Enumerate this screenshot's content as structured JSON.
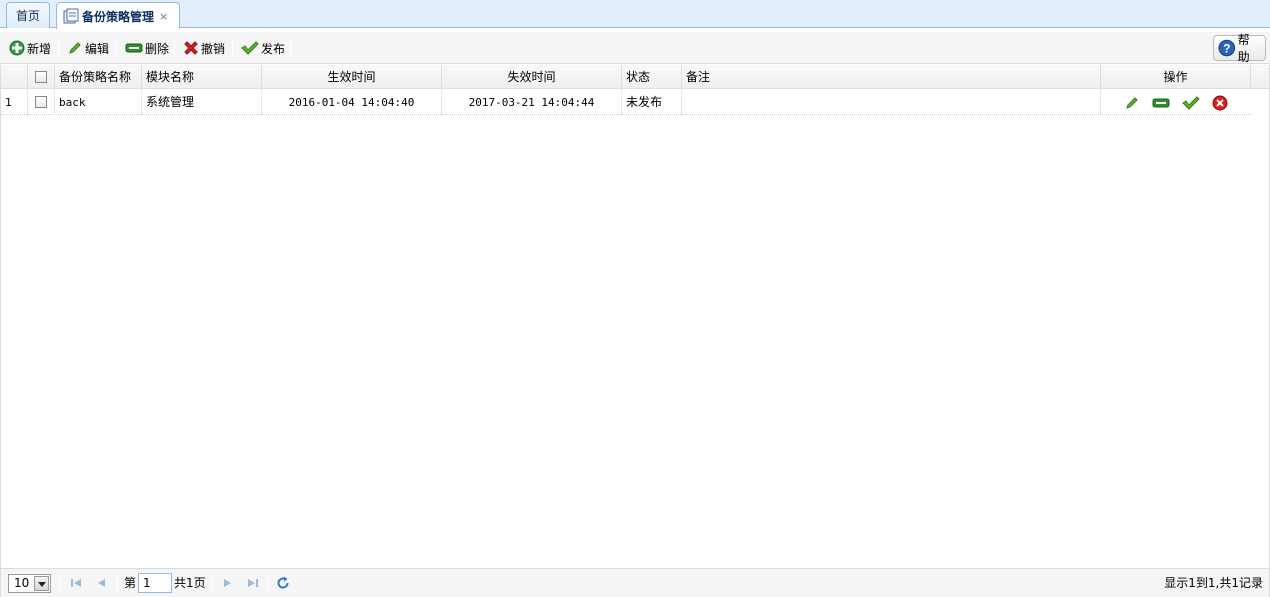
{
  "tabs": [
    {
      "label": "首页"
    },
    {
      "label": "备份策略管理"
    }
  ],
  "tab_close_glyph": "×",
  "toolbar": {
    "add": "新增",
    "edit": "编辑",
    "delete": "删除",
    "revoke": "撤销",
    "publish": "发布",
    "help": "帮助"
  },
  "grid": {
    "columns": [
      "备份策略名称",
      "模块名称",
      "生效时间",
      "失效时间",
      "状态",
      "备注",
      "操作"
    ],
    "rows": [
      {
        "index": "1",
        "name": "back",
        "module": "系统管理",
        "effective": "2016-01-04 14:04:40",
        "expire": "2017-03-21 14:04:44",
        "status": "未发布",
        "remark": ""
      }
    ]
  },
  "pager": {
    "page_size": "10",
    "page_prefix": "第",
    "page_number": "1",
    "page_total": "共1页",
    "info": "显示1到1,共1记录"
  },
  "colors": {
    "tab_border": "#95b8e7",
    "add_green": "#2e9e3b",
    "delete_red": "#d9201c",
    "help_blue": "#2a63b8"
  },
  "icons": [
    "tab-page-icon",
    "add-icon",
    "edit-icon",
    "delete-icon",
    "revoke-icon",
    "publish-icon",
    "help-icon",
    "first-page-icon",
    "prev-page-icon",
    "next-page-icon",
    "last-page-icon",
    "refresh-icon"
  ]
}
